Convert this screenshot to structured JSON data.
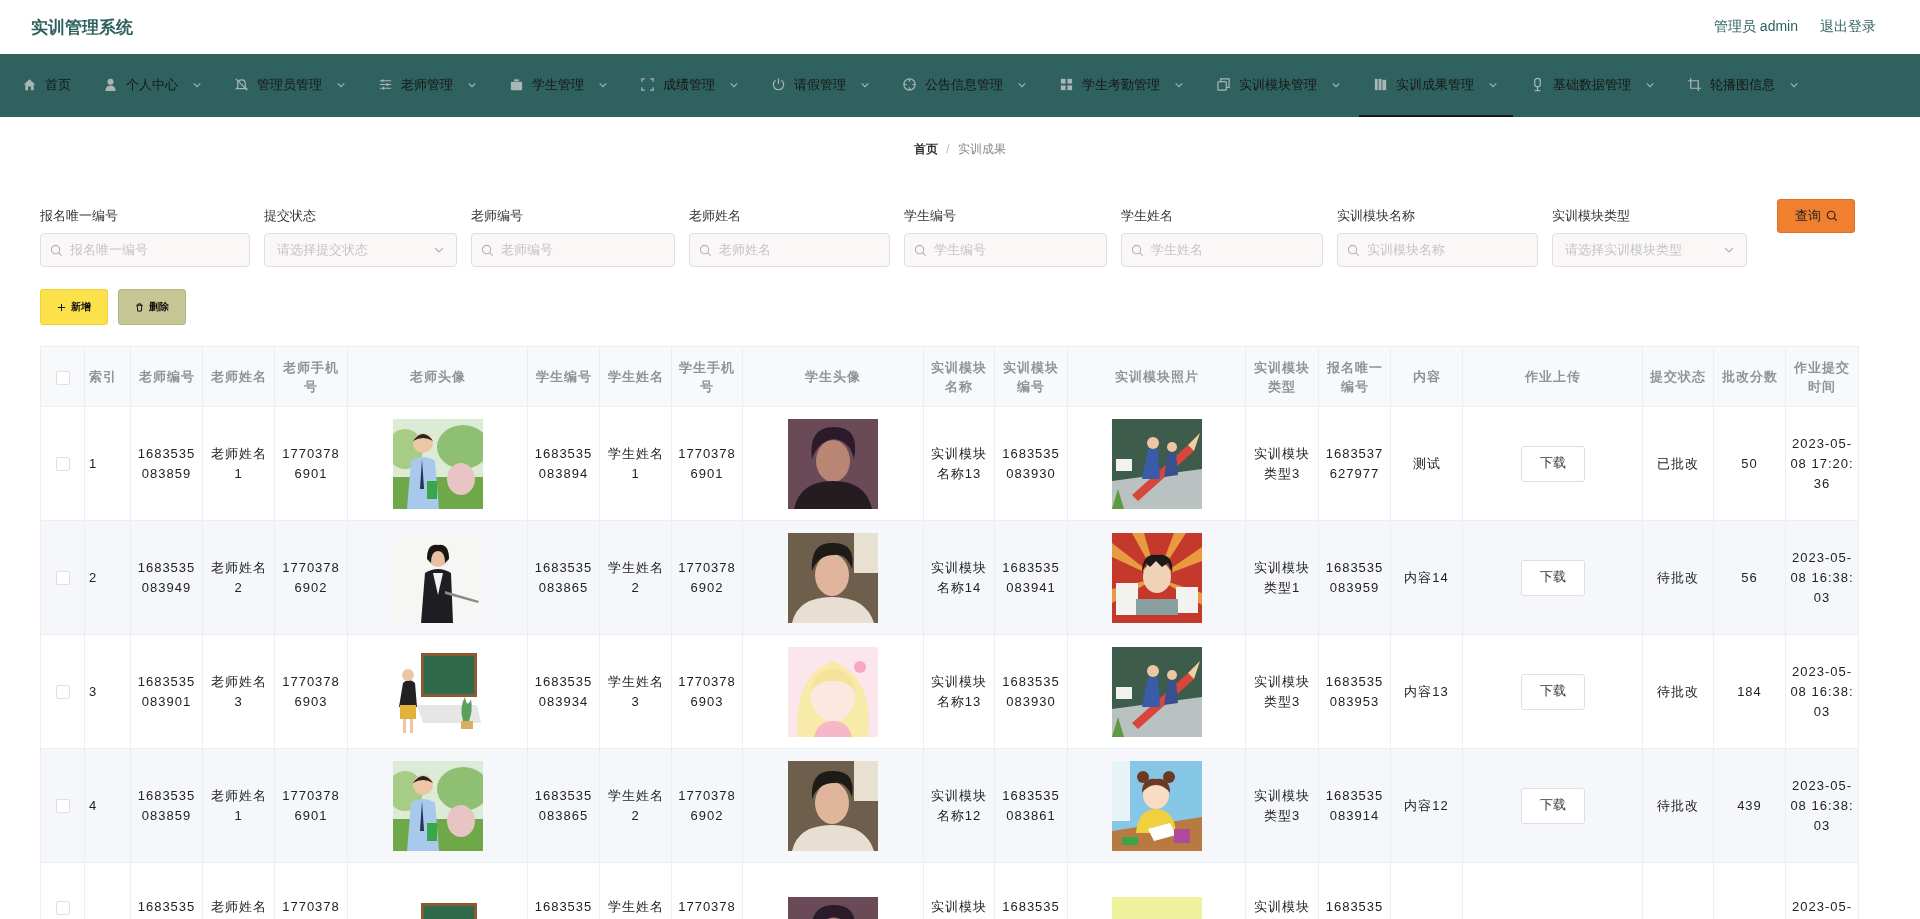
{
  "header": {
    "title": "实训管理系统",
    "user": "管理员 admin",
    "logout": "退出登录"
  },
  "nav": {
    "items": [
      {
        "label": "首页",
        "selected": false,
        "has_menu": false
      },
      {
        "label": "个人中心",
        "selected": false,
        "has_menu": true
      },
      {
        "label": "管理员管理",
        "selected": false,
        "has_menu": true
      },
      {
        "label": "老师管理",
        "selected": false,
        "has_menu": true
      },
      {
        "label": "学生管理",
        "selected": false,
        "has_menu": true
      },
      {
        "label": "成绩管理",
        "selected": false,
        "has_menu": true
      },
      {
        "label": "请假管理",
        "selected": false,
        "has_menu": true
      },
      {
        "label": "公告信息管理",
        "selected": false,
        "has_menu": true
      },
      {
        "label": "学生考勤管理",
        "selected": false,
        "has_menu": true
      },
      {
        "label": "实训模块管理",
        "selected": false,
        "has_menu": true
      },
      {
        "label": "实训成果管理",
        "selected": true,
        "has_menu": true
      },
      {
        "label": "基础数据管理",
        "selected": false,
        "has_menu": true
      },
      {
        "label": "轮播图信息",
        "selected": false,
        "has_menu": true
      }
    ]
  },
  "breadcrumb": {
    "items": [
      "首页",
      "实训成果"
    ],
    "separator": "/"
  },
  "filters": [
    {
      "label": "报名唯一编号",
      "placeholder": "报名唯一编号",
      "kind": "input"
    },
    {
      "label": "提交状态",
      "placeholder": "请选择提交状态",
      "kind": "select"
    },
    {
      "label": "老师编号",
      "placeholder": "老师编号",
      "kind": "input"
    },
    {
      "label": "老师姓名",
      "placeholder": "老师姓名",
      "kind": "input"
    },
    {
      "label": "学生编号",
      "placeholder": "学生编号",
      "kind": "input"
    },
    {
      "label": "学生姓名",
      "placeholder": "学生姓名",
      "kind": "input"
    },
    {
      "label": "实训模块名称",
      "placeholder": "实训模块名称",
      "kind": "input"
    },
    {
      "label": "实训模块类型",
      "placeholder": "请选择实训模块类型",
      "kind": "select"
    }
  ],
  "query_button": "查询",
  "actions": {
    "add": "新增",
    "delete": "删除"
  },
  "table": {
    "header_checked": false,
    "columns": [
      {
        "label": "索引",
        "kind": "text"
      },
      {
        "label": "老师编号",
        "kind": "text"
      },
      {
        "label": "老师姓名",
        "kind": "text"
      },
      {
        "label": "老师手机号",
        "kind": "text"
      },
      {
        "label": "老师头像",
        "kind": "picture"
      },
      {
        "label": "学生编号",
        "kind": "text"
      },
      {
        "label": "学生姓名",
        "kind": "text"
      },
      {
        "label": "学生手机号",
        "kind": "text"
      },
      {
        "label": "学生头像",
        "kind": "picture"
      },
      {
        "label": "实训模块名称",
        "kind": "text"
      },
      {
        "label": "实训模块编号",
        "kind": "text"
      },
      {
        "label": "实训模块照片",
        "kind": "picture"
      },
      {
        "label": "实训模块类型",
        "kind": "text"
      },
      {
        "label": "报名唯一编号",
        "kind": "text"
      },
      {
        "label": "内容",
        "kind": "text"
      },
      {
        "label": "作业上传",
        "kind": "button"
      },
      {
        "label": "提交状态",
        "kind": "text"
      },
      {
        "label": "批改分数",
        "kind": "text"
      },
      {
        "label": "作业提交时间",
        "kind": "text"
      }
    ],
    "rows": [
      {
        "checked": false,
        "index": "1",
        "teacher_no": "1683535083859",
        "teacher_name": "老师姓名1",
        "teacher_phone": "17703786901",
        "student_no": "1683535083894",
        "student_name": "学生姓名1",
        "student_phone": "17703786901",
        "module_name": "实训模块名称13",
        "module_no": "1683535083930",
        "module_type": "实训模块类型3",
        "enroll_no": "1683537627977",
        "content": "测试",
        "upload": "下载",
        "status": "已批改",
        "score": "50",
        "time": "2023-05-08 17:20:36"
      },
      {
        "checked": false,
        "index": "2",
        "teacher_no": "1683535083949",
        "teacher_name": "老师姓名2",
        "teacher_phone": "17703786902",
        "student_no": "1683535083865",
        "student_name": "学生姓名2",
        "student_phone": "17703786902",
        "module_name": "实训模块名称14",
        "module_no": "1683535083941",
        "module_type": "实训模块类型1",
        "enroll_no": "1683535083959",
        "content": "内容14",
        "upload": "下载",
        "status": "待批改",
        "score": "56",
        "time": "2023-05-08 16:38:03"
      },
      {
        "checked": false,
        "index": "3",
        "teacher_no": "1683535083901",
        "teacher_name": "老师姓名3",
        "teacher_phone": "17703786903",
        "student_no": "1683535083934",
        "student_name": "学生姓名3",
        "student_phone": "17703786903",
        "module_name": "实训模块名称13",
        "module_no": "1683535083930",
        "module_type": "实训模块类型3",
        "enroll_no": "1683535083953",
        "content": "内容13",
        "upload": "下载",
        "status": "待批改",
        "score": "184",
        "time": "2023-05-08 16:38:03"
      },
      {
        "checked": false,
        "index": "4",
        "teacher_no": "1683535083859",
        "teacher_name": "老师姓名1",
        "teacher_phone": "17703786901",
        "student_no": "1683535083865",
        "student_name": "学生姓名2",
        "student_phone": "17703786902",
        "module_name": "实训模块名称12",
        "module_no": "1683535083861",
        "module_type": "实训模块类型3",
        "enroll_no": "1683535083914",
        "content": "内容12",
        "upload": "下载",
        "status": "待批改",
        "score": "439",
        "time": "2023-05-08 16:38:03"
      },
      {
        "checked": false,
        "teacher_no": "1683535",
        "teacher_name": "老师姓名",
        "teacher_phone": "1770378",
        "student_no": "1683535",
        "student_name": "学生姓名",
        "student_phone": "1770378",
        "module_name": "实训模块",
        "module_no": "1683535",
        "module_type": "实训模块",
        "enroll_no": "1683535",
        "time": "2023-05-"
      }
    ]
  }
}
